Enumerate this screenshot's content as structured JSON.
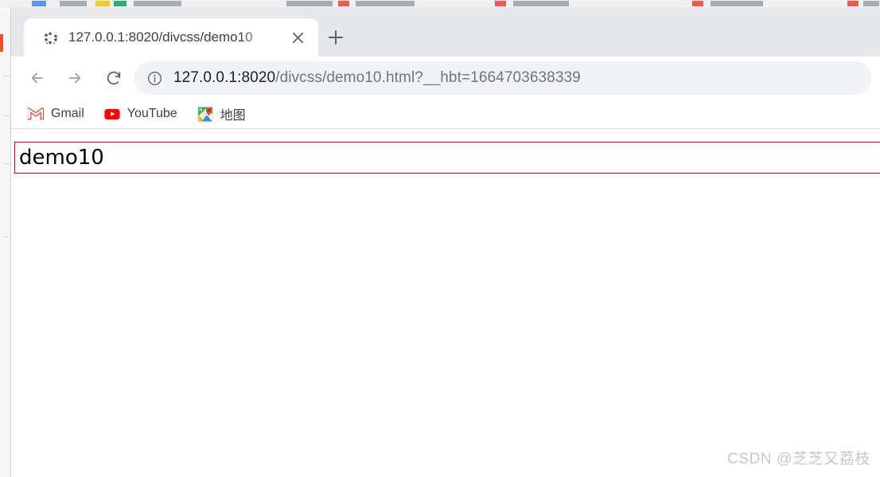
{
  "window": {
    "background_window_hint": "partially visible window behind on top and left edges"
  },
  "tabstrip": {
    "tabs": [
      {
        "title": "127.0.0.1:8020/divcss/demo10",
        "favicon": "globe-icon",
        "active": true,
        "close_label": "×"
      }
    ],
    "new_tab_label": "+"
  },
  "toolbar": {
    "back_label": "←",
    "forward_label": "→",
    "reload_label": "↻",
    "site_info_icon": "info-circle-icon",
    "url_host": "127.0.0.1:8020",
    "url_path": "/divcss/demo10.html?__hbt=1664703638339",
    "url_full": "127.0.0.1:8020/divcss/demo10.html?__hbt=1664703638339"
  },
  "bookmarks": {
    "items": [
      {
        "label": "Gmail",
        "icon": "gmail-icon"
      },
      {
        "label": "YouTube",
        "icon": "youtube-icon"
      },
      {
        "label": "地图",
        "icon": "google-maps-icon"
      }
    ]
  },
  "page": {
    "box_text": "demo10",
    "box_border_color": "#e60000",
    "watermark": "CSDN @芝芝又荔枝"
  }
}
